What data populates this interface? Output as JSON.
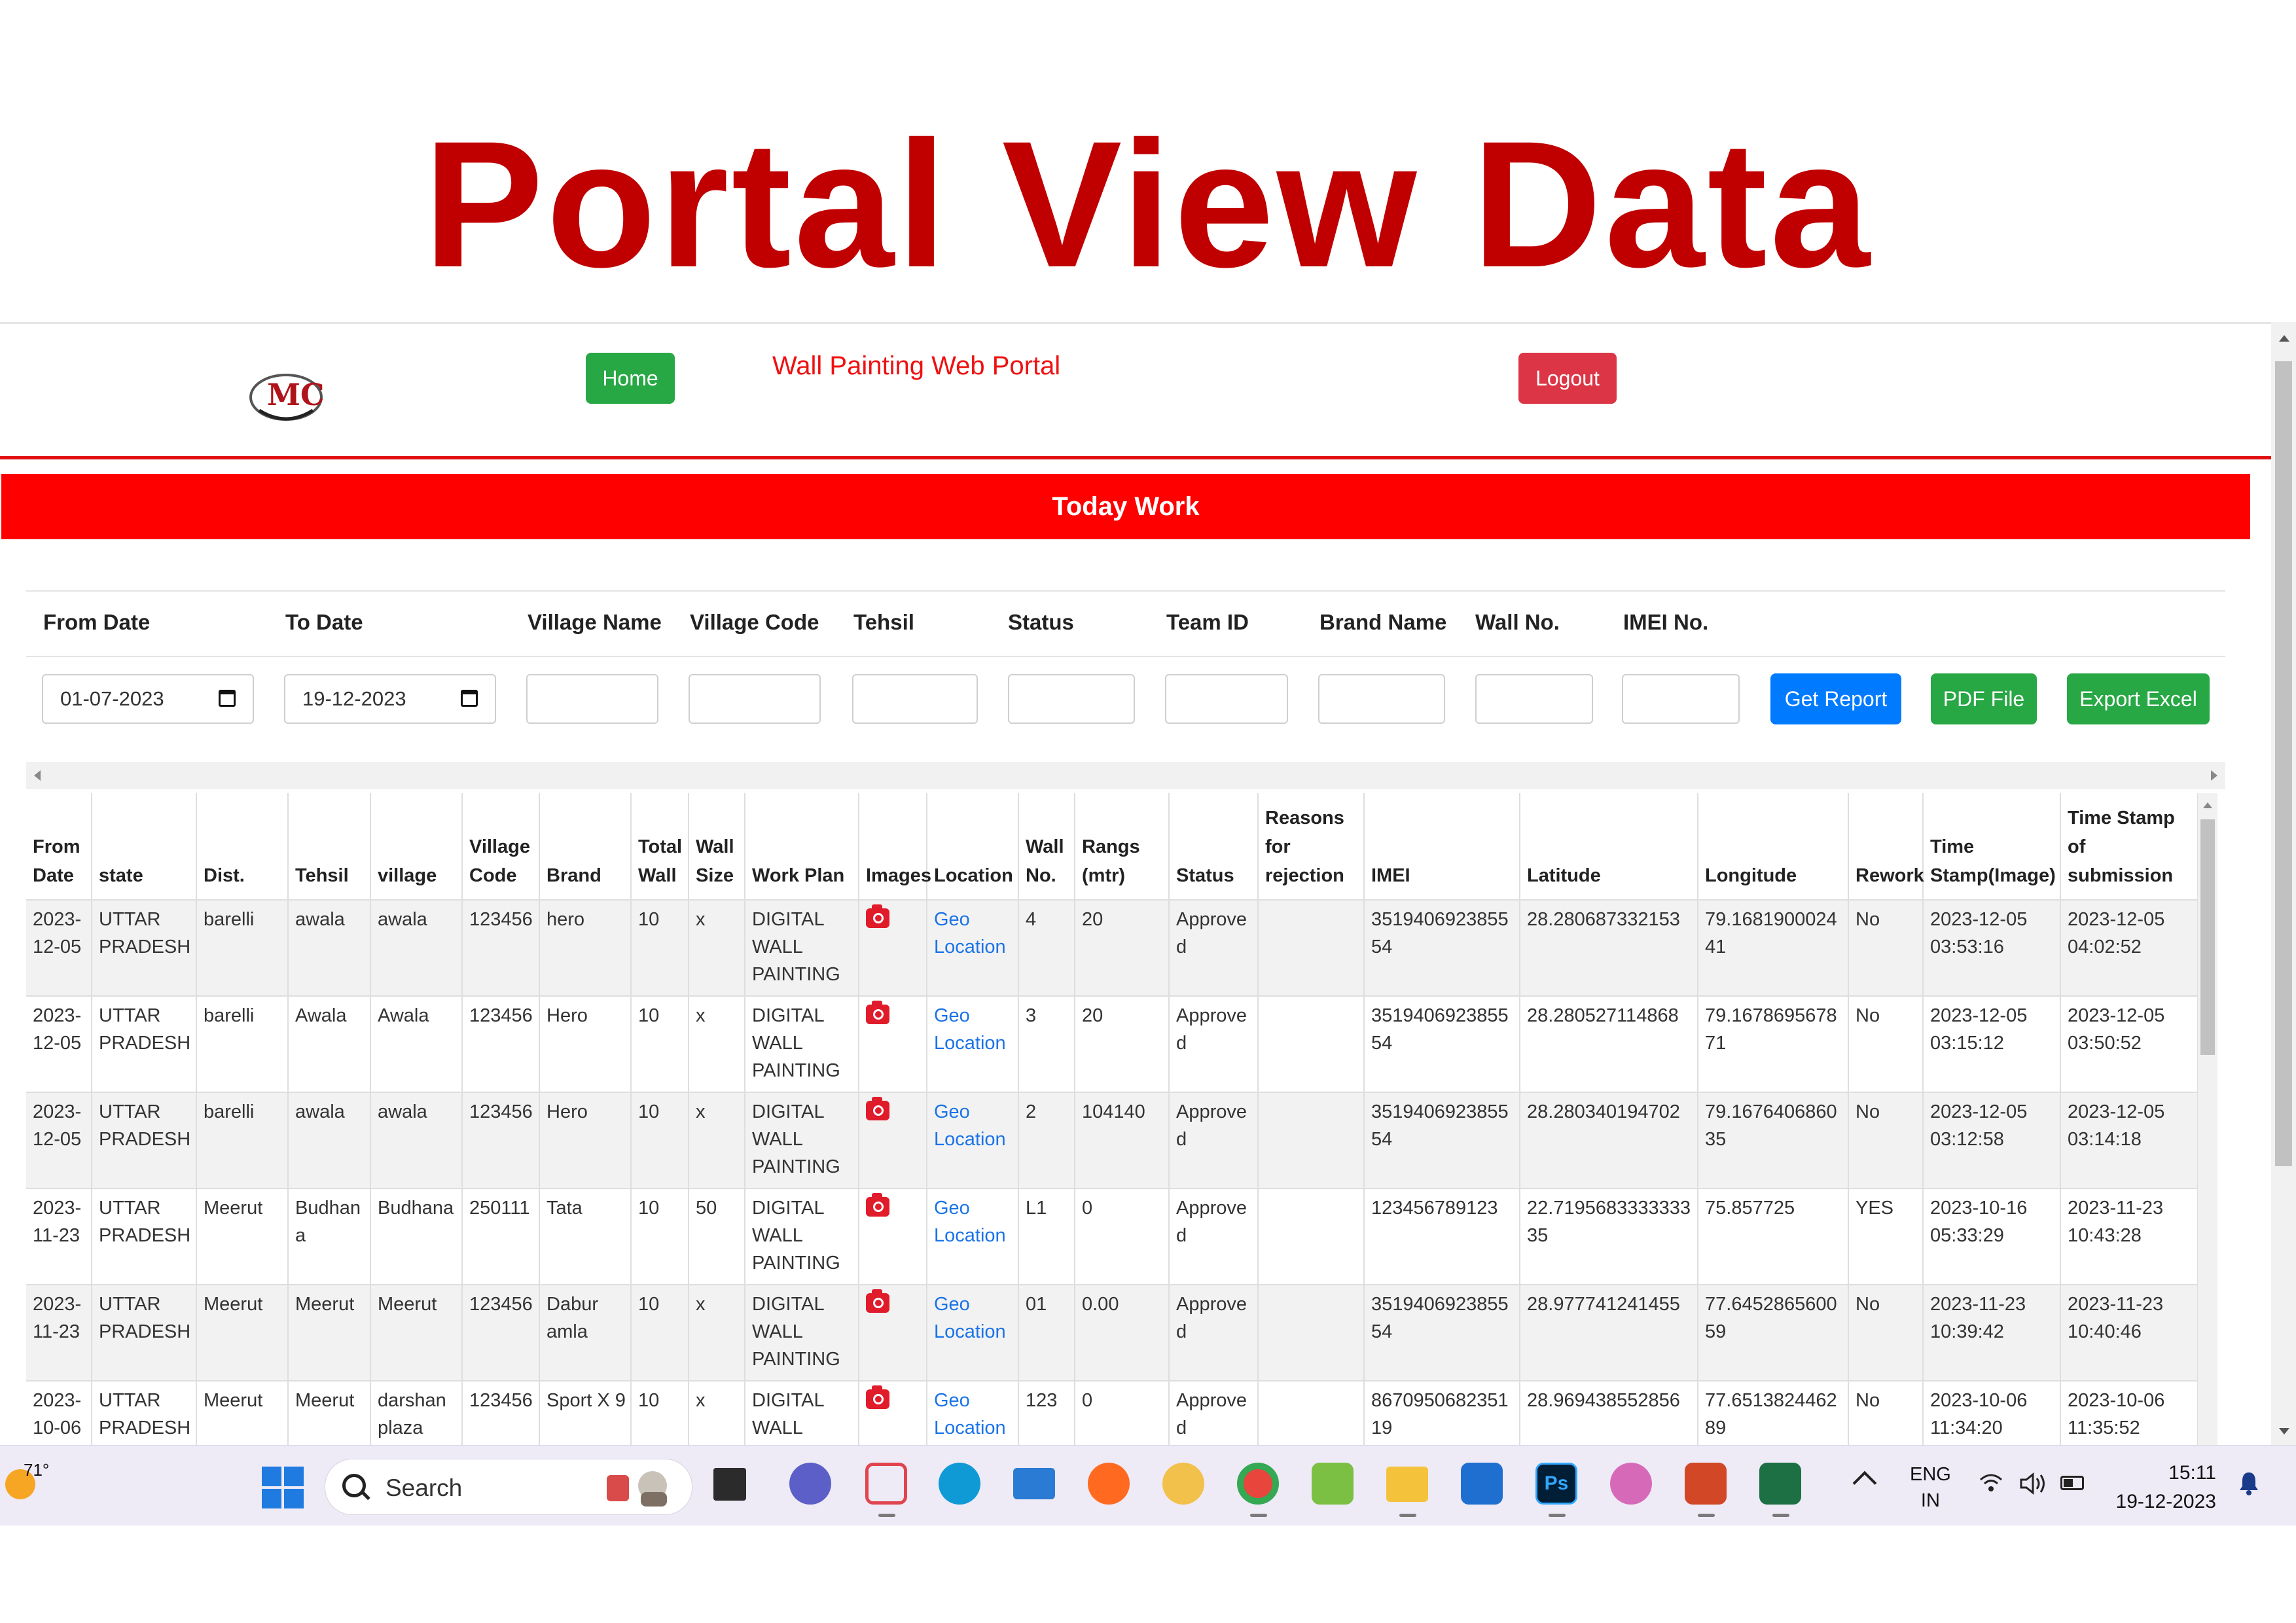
{
  "slide": {
    "title": "Portal View Data"
  },
  "navbar": {
    "logo_text": "MC",
    "home_label": "Home",
    "portal_title": "Wall Painting Web Portal",
    "logout_label": "Logout"
  },
  "banner": {
    "title": "Today Work"
  },
  "filters": {
    "labels": [
      "From Date",
      "To Date",
      "Village Name",
      "Village Code",
      "Tehsil",
      "Status",
      "Team ID",
      "Brand Name",
      "Wall No.",
      "IMEI No."
    ],
    "from_date": "01-07-2023",
    "to_date": "19-12-2023",
    "get_report_label": "Get Report",
    "pdf_label": "PDF File",
    "excel_label": "Export Excel"
  },
  "table": {
    "columns": [
      "From Date",
      "state",
      "Dist.",
      "Tehsil",
      "village",
      "Village Code",
      "Brand",
      "Total Wall",
      "Wall Size",
      "Work Plan",
      "Images",
      "Location",
      "Wall No.",
      "Rangs (mtr)",
      "Status",
      "Reasons for rejection",
      "IMEI",
      "Latitude",
      "Longitude",
      "Rework",
      "Time Stamp(Image)",
      "Time Stamp of submission"
    ],
    "rows": [
      [
        "2023-12-05",
        "UTTAR PRADESH",
        "barelli",
        "awala",
        "awala",
        "123456",
        "hero",
        "10",
        "x",
        "DIGITAL WALL PAINTING",
        "",
        "Geo Location",
        "4",
        "20",
        "Approved",
        "",
        "351940692385554",
        "28.280687332153",
        "79.168190002441",
        "No",
        "2023-12-05 03:53:16",
        "2023-12-05 04:02:52"
      ],
      [
        "2023-12-05",
        "UTTAR PRADESH",
        "barelli",
        "Awala",
        "Awala",
        "123456",
        "Hero",
        "10",
        "x",
        "DIGITAL WALL PAINTING",
        "",
        "Geo Location",
        "3",
        "20",
        "Approved",
        "",
        "351940692385554",
        "28.280527114868",
        "79.167869567871",
        "No",
        "2023-12-05 03:15:12",
        "2023-12-05 03:50:52"
      ],
      [
        "2023-12-05",
        "UTTAR PRADESH",
        "barelli",
        "awala",
        "awala",
        "123456",
        "Hero",
        "10",
        "x",
        "DIGITAL WALL PAINTING",
        "",
        "Geo Location",
        "2",
        "104140",
        "Approved",
        "",
        "351940692385554",
        "28.280340194702",
        "79.167640686035",
        "No",
        "2023-12-05 03:12:58",
        "2023-12-05 03:14:18"
      ],
      [
        "2023-11-23",
        "UTTAR PRADESH",
        "Meerut",
        "Budhana",
        "Budhana",
        "250111",
        "Tata",
        "10",
        "50",
        "DIGITAL WALL PAINTING",
        "",
        "Geo Location",
        "L1",
        "0",
        "Approved",
        "",
        "123456789123",
        "22.719568333333335",
        "75.857725",
        "YES",
        "2023-10-16 05:33:29",
        "2023-11-23 10:43:28"
      ],
      [
        "2023-11-23",
        "UTTAR PRADESH",
        "Meerut",
        "Meerut",
        "Meerut",
        "123456",
        "Dabur amla",
        "10",
        "x",
        "DIGITAL WALL PAINTING",
        "",
        "Geo Location",
        "01",
        "0.00",
        "Approved",
        "",
        "351940692385554",
        "28.977741241455",
        "77.645286560059",
        "No",
        "2023-11-23 10:39:42",
        "2023-11-23 10:40:46"
      ],
      [
        "2023-10-06",
        "UTTAR PRADESH",
        "Meerut",
        "Meerut",
        "darshan plaza",
        "123456",
        "Sport X 9",
        "10",
        "x",
        "DIGITAL WALL PAINTING",
        "",
        "Geo Location",
        "123",
        "0",
        "Approved",
        "",
        "867095068235119",
        "28.969438552856",
        "77.651382446289",
        "No",
        "2023-10-06 11:34:20",
        "2023-10-06 11:35:52"
      ]
    ]
  },
  "taskbar": {
    "temperature": "71°",
    "search_placeholder": "Search",
    "lang_line1": "ENG",
    "lang_line2": "IN",
    "time": "15:11",
    "date": "19-12-2023",
    "apps": [
      "task-view",
      "chat",
      "snipping-tool",
      "edge",
      "mail",
      "firefox",
      "photos",
      "chrome",
      "notepad-plus",
      "file-explorer",
      "store",
      "photoshop",
      "paint",
      "powerpoint",
      "excel"
    ]
  },
  "colors": {
    "title_red": "#c00000",
    "banner_red": "#ff0000",
    "success_green": "#28a745",
    "danger_red": "#dc3545",
    "primary_blue": "#007bff",
    "link_blue": "#1a73e8"
  }
}
